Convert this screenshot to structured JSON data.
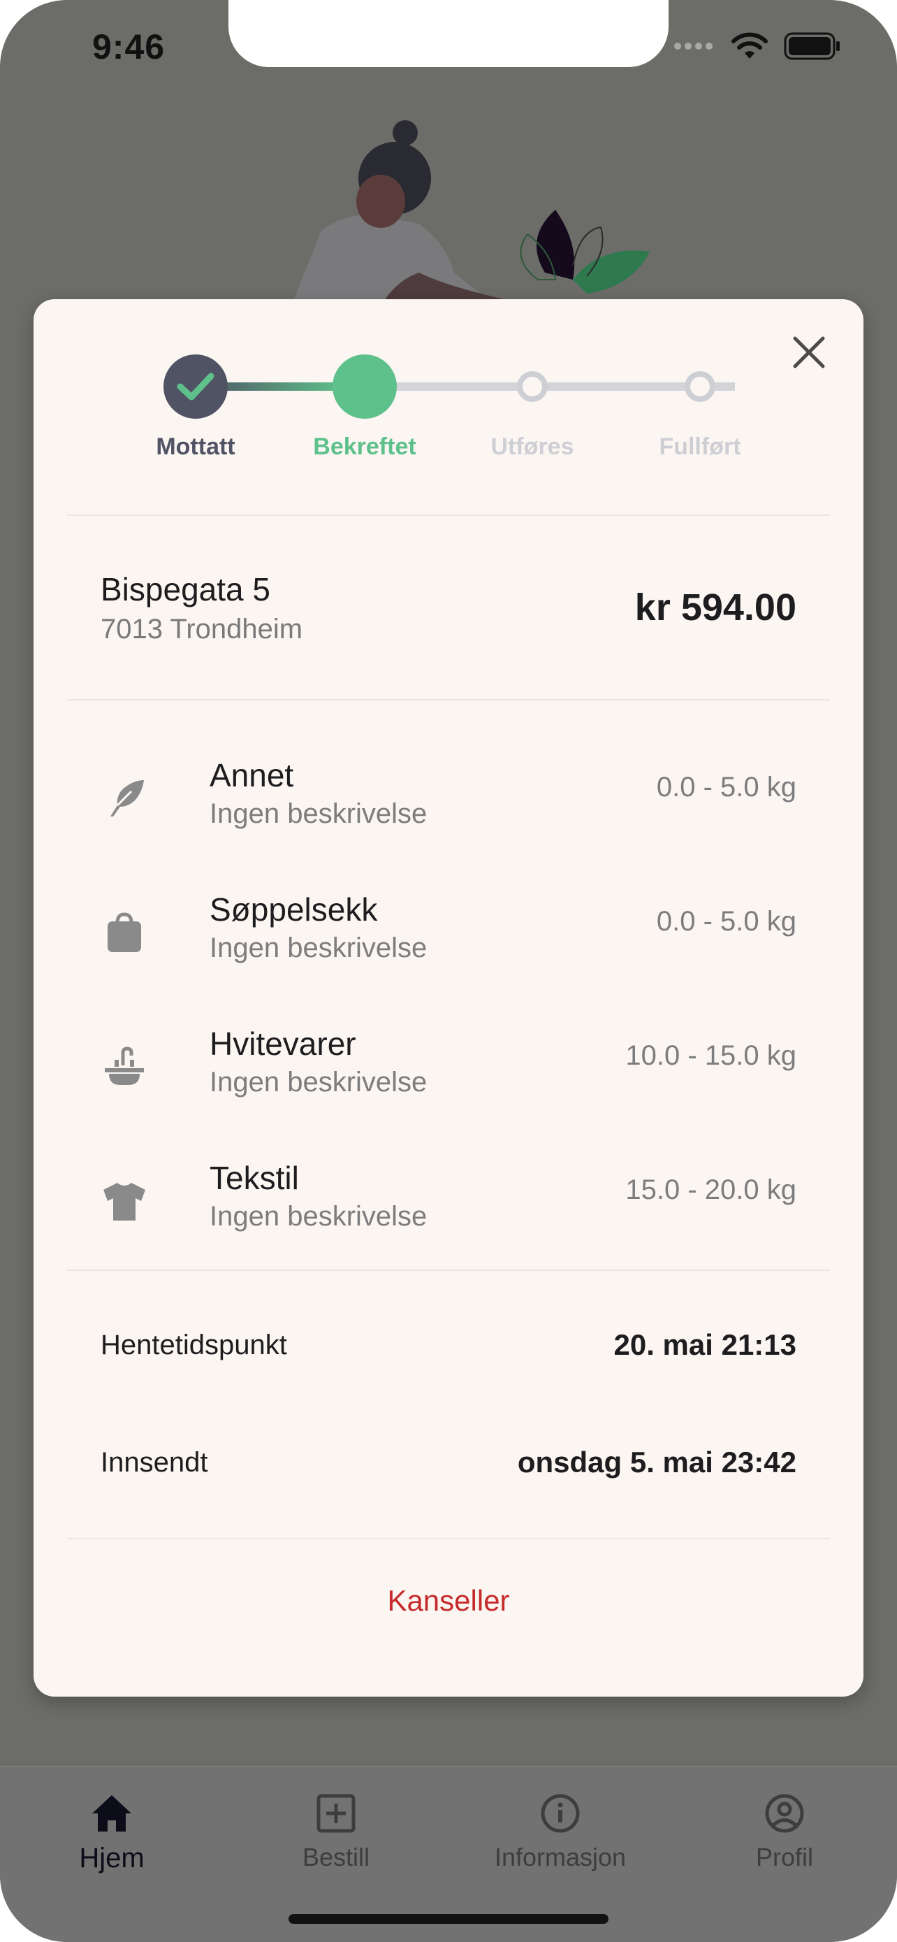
{
  "status_bar": {
    "time": "9:46"
  },
  "stepper": {
    "steps": [
      {
        "label": "Mottatt",
        "state": "done",
        "color": "#505364"
      },
      {
        "label": "Bekreftet",
        "state": "active",
        "color": "#5ec08a"
      },
      {
        "label": "Utføres",
        "state": "pending",
        "color": "#cdcfd4"
      },
      {
        "label": "Fullført",
        "state": "pending",
        "color": "#cdcfd4"
      }
    ]
  },
  "address": {
    "street": "Bispegata 5",
    "postal": "7013 Trondheim"
  },
  "price": "kr 594.00",
  "items": [
    {
      "icon": "feather-icon",
      "title": "Annet",
      "description": "Ingen beskrivelse",
      "weight": "0.0 - 5.0 kg"
    },
    {
      "icon": "bag-icon",
      "title": "Søppelsekk",
      "description": "Ingen beskrivelse",
      "weight": "0.0 - 5.0 kg"
    },
    {
      "icon": "sink-icon",
      "title": "Hvitevarer",
      "description": "Ingen beskrivelse",
      "weight": "10.0 - 15.0 kg"
    },
    {
      "icon": "shirt-icon",
      "title": "Tekstil",
      "description": "Ingen beskrivelse",
      "weight": "15.0 - 20.0 kg"
    }
  ],
  "details": {
    "pickup_label": "Hentetidspunkt",
    "pickup_value": "20. mai 21:13",
    "submitted_label": "Innsendt",
    "submitted_value": "onsdag 5. mai 23:42"
  },
  "cancel_label": "Kanseller",
  "tabs": [
    {
      "label": "Hjem",
      "icon": "home-icon",
      "active": true
    },
    {
      "label": "Bestill",
      "icon": "add-box-icon",
      "active": false
    },
    {
      "label": "Informasjon",
      "icon": "info-icon",
      "active": false
    },
    {
      "label": "Profil",
      "icon": "profile-icon",
      "active": false
    }
  ],
  "colors": {
    "accent": "#5ec08a",
    "danger": "#c62a2a",
    "card": "#fcf6f3",
    "overlay": "#6c6c69"
  }
}
